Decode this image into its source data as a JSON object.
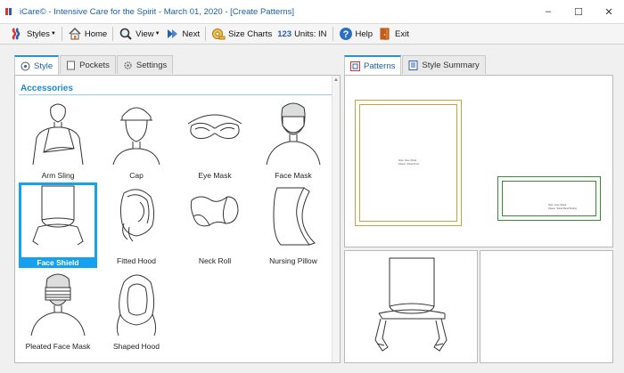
{
  "window": {
    "title": "iCare© - Intensive Care for the Spirit - March 01, 2020 - [Create Patterns]",
    "controls": [
      "–",
      "☐",
      "✕"
    ]
  },
  "toolbar": {
    "styles": "Styles",
    "home": "Home",
    "view": "View",
    "next": "Next",
    "size_charts": "Size Charts",
    "units_prefix": "123",
    "units": "Units: IN",
    "help": "Help",
    "exit": "Exit"
  },
  "left_tabs": [
    "Style",
    "Pockets",
    "Settings"
  ],
  "right_tabs": [
    "Patterns",
    "Style Summary"
  ],
  "section": "Accessories",
  "items": [
    {
      "label": "Arm Sling",
      "icon": "arm-sling"
    },
    {
      "label": "Cap",
      "icon": "cap"
    },
    {
      "label": "Eye Mask",
      "icon": "eye-mask"
    },
    {
      "label": "Face Mask",
      "icon": "face-mask"
    },
    {
      "label": "Face Shield",
      "icon": "face-shield",
      "selected": true
    },
    {
      "label": "Fitted Hood",
      "icon": "fitted-hood"
    },
    {
      "label": "Neck Roll",
      "icon": "neck-roll"
    },
    {
      "label": "Nursing Pillow",
      "icon": "nursing-pillow"
    },
    {
      "label": "Pleated Face Mask",
      "icon": "pleated-face-mask"
    },
    {
      "label": "Shaped Hood",
      "icon": "shaped-hood"
    }
  ],
  "pattern_notes": {
    "piece1": [
      "Style: Face Shield",
      "Pattern: Shield Front"
    ],
    "piece2": [
      "Style: Face Shield",
      "Pattern: Shield Band Binding"
    ]
  },
  "colors": {
    "accent": "#16a0f0",
    "title": "#1a5fa8",
    "piece1": "#c8a23c",
    "piece2": "#3a8a3a"
  }
}
